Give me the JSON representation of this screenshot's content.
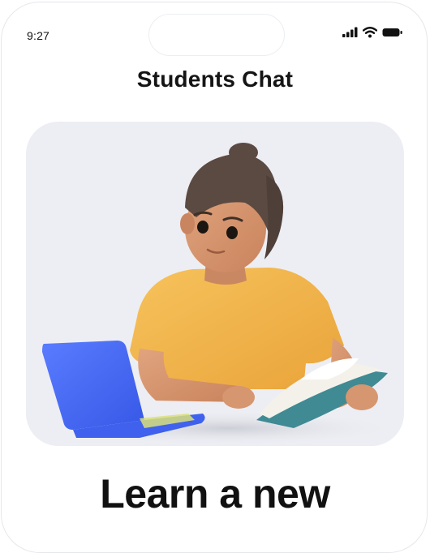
{
  "status_bar": {
    "time": "9:27",
    "icons": [
      "signal-icon",
      "wifi-icon",
      "battery-icon"
    ]
  },
  "header": {
    "title": "Students Chat"
  },
  "hero": {
    "illustration": "student-studying-illustration"
  },
  "onboarding": {
    "headline": "Learn a new"
  },
  "colors": {
    "background": "#ffffff",
    "hero_card": "#edeef3",
    "text": "#151515",
    "shirt": "#f3b54a",
    "laptop": "#4a6ef5",
    "book_cover": "#3f8a93"
  }
}
